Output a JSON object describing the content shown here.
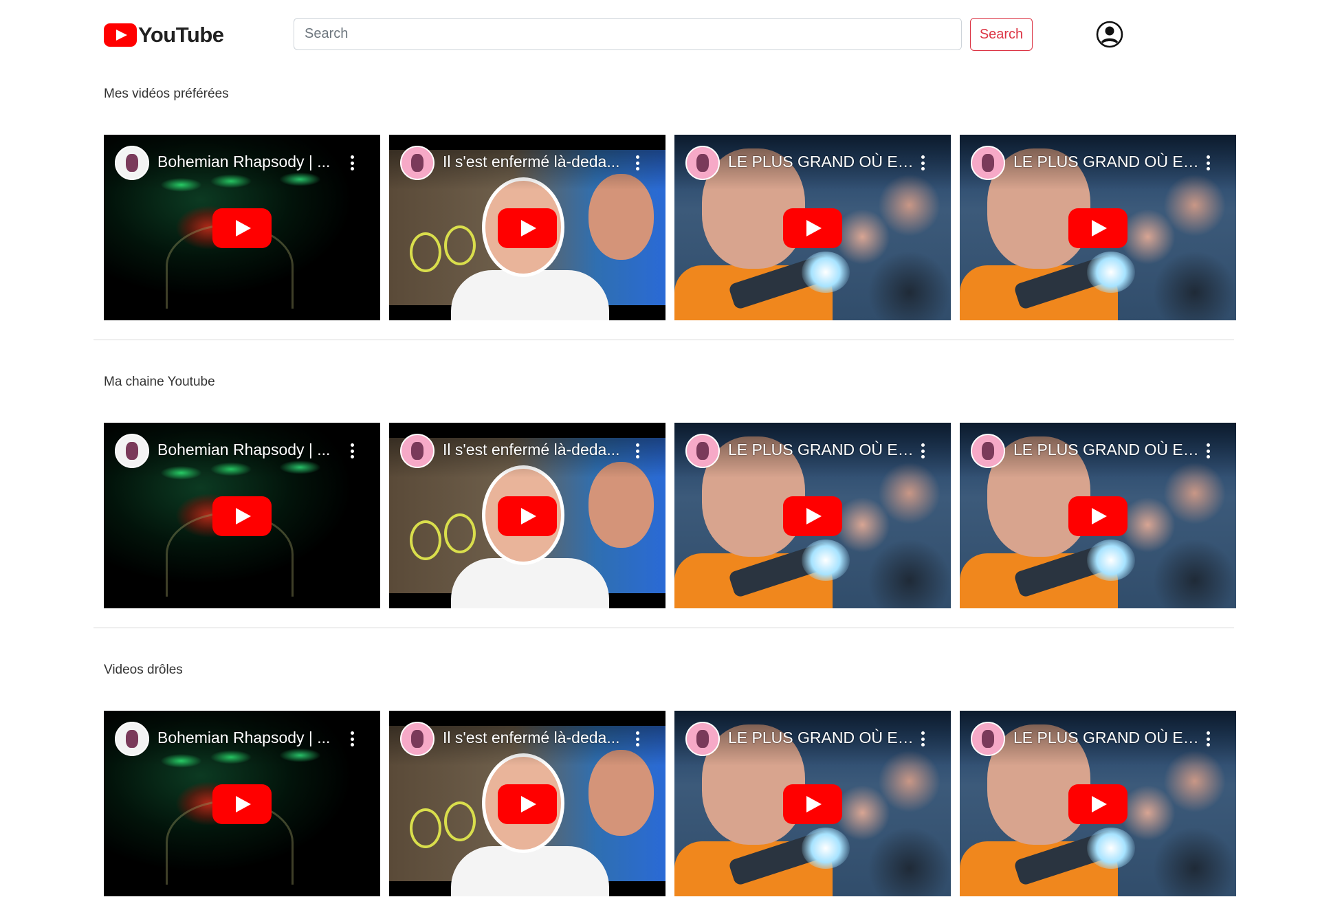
{
  "header": {
    "brand": "YouTube",
    "search_placeholder": "Search",
    "search_button": "Search"
  },
  "sections": [
    {
      "title": "Mes vidéos préférées",
      "videos": [
        {
          "title": "Bohemian Rhapsody | ...",
          "thumb": "boh"
        },
        {
          "title": "Il s'est enfermé là-deda...",
          "thumb": "enf"
        },
        {
          "title": "LE PLUS GRAND OÙ ES...",
          "thumb": "plus"
        },
        {
          "title": "LE PLUS GRAND OÙ ES...",
          "thumb": "plus"
        }
      ]
    },
    {
      "title": "Ma chaine Youtube",
      "videos": [
        {
          "title": "Bohemian Rhapsody | ...",
          "thumb": "boh"
        },
        {
          "title": "Il s'est enfermé là-deda...",
          "thumb": "enf"
        },
        {
          "title": "LE PLUS GRAND OÙ ES...",
          "thumb": "plus"
        },
        {
          "title": "LE PLUS GRAND OÙ ES...",
          "thumb": "plus"
        }
      ]
    },
    {
      "title": "Videos drôles",
      "videos": [
        {
          "title": "Bohemian Rhapsody | ...",
          "thumb": "boh"
        },
        {
          "title": "Il s'est enfermé là-deda...",
          "thumb": "enf"
        },
        {
          "title": "LE PLUS GRAND OÙ ES...",
          "thumb": "plus"
        },
        {
          "title": "LE PLUS GRAND OÙ ES...",
          "thumb": "plus"
        }
      ]
    }
  ],
  "colors": {
    "youtube_red": "#ff0000",
    "search_button_red": "#dc3545"
  },
  "icons": {
    "brand": "youtube-logo-icon",
    "profile": "user-circle-icon",
    "play": "play-icon",
    "menu": "kebab-menu-icon",
    "channel": "channel-avatar"
  }
}
